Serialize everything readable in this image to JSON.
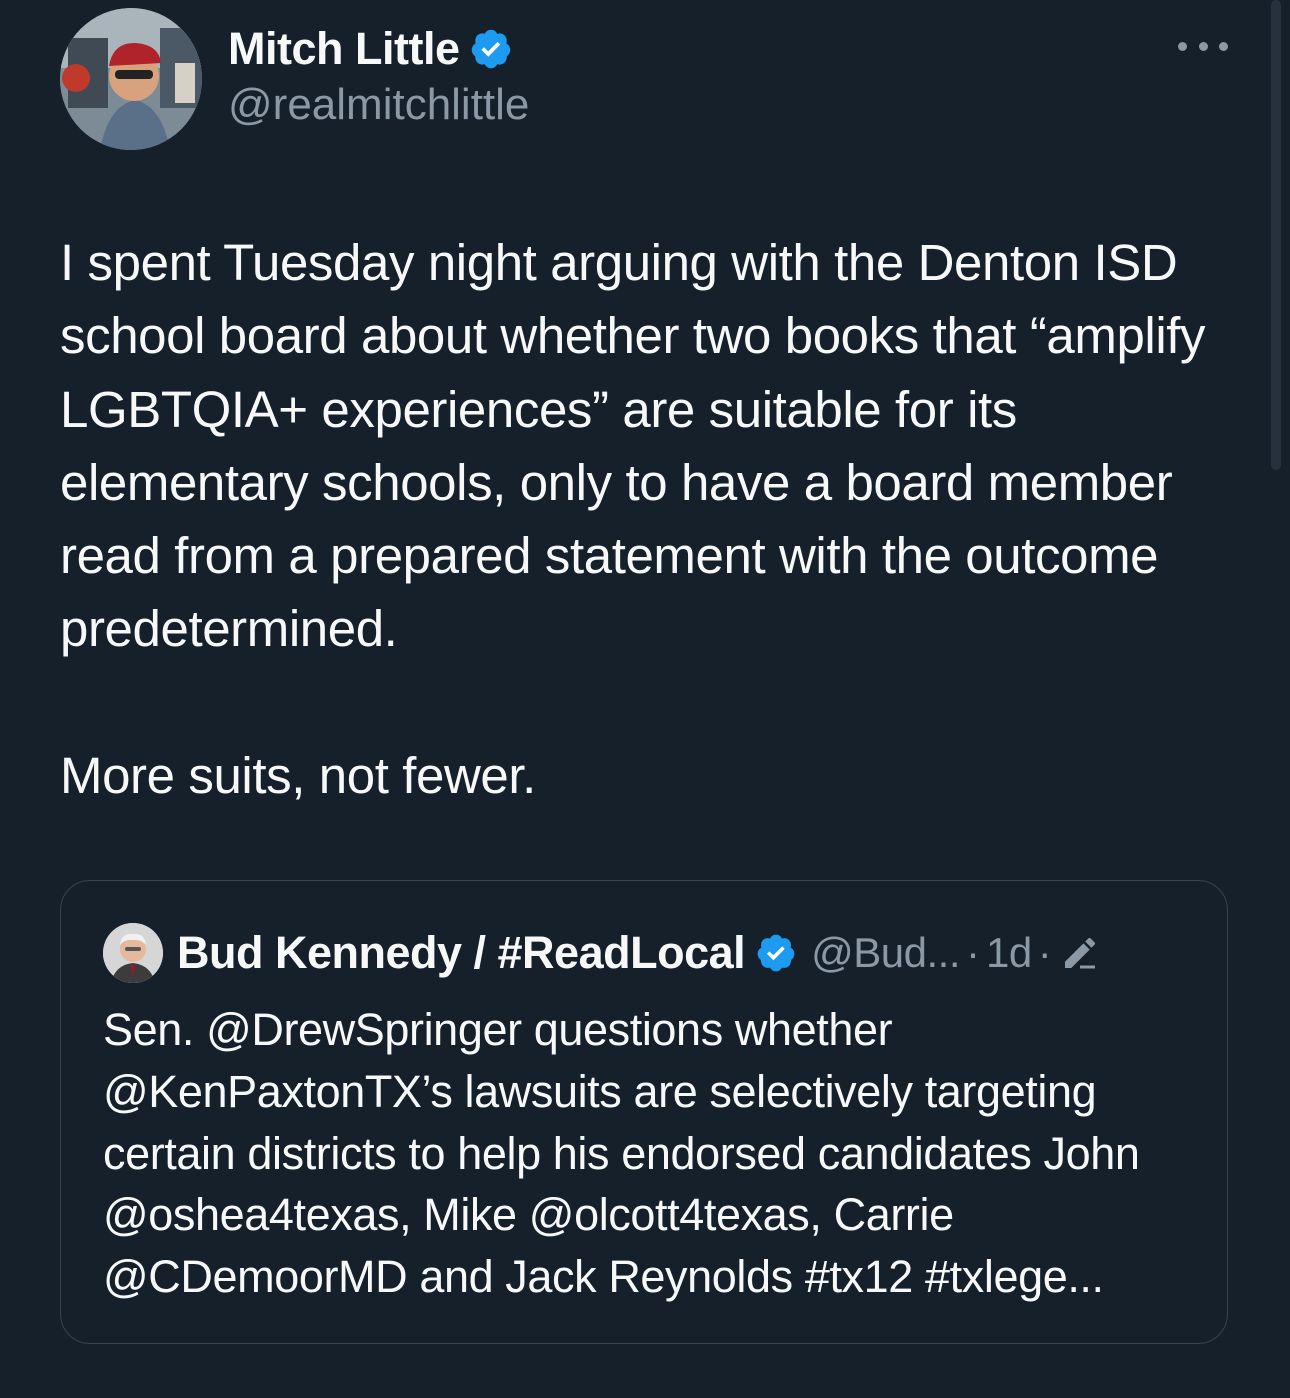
{
  "tweet": {
    "author": {
      "display_name": "Mitch Little",
      "handle": "@realmitchlittle",
      "verified": true
    },
    "more_icon": "more-horizontal-icon",
    "text": "I spent Tuesday night arguing with the Denton ISD school board about whether two books that “amplify LGBTQIA+ experiences” are suitable for its elementary schools, only to have a board member read from a prepared statement with the outcome predetermined.\n\nMore suits, not fewer.",
    "quoted_tweet": {
      "display_name": "Bud Kennedy / #ReadLocal",
      "handle": "@Bud...",
      "separator": "·",
      "time": "1d",
      "verified": true,
      "edited_icon": "edit-pencil-icon",
      "text": "Sen. @DrewSpringer questions whether @KenPaxtonTX’s lawsuits are selectively targeting certain districts to help his endorsed candidates John @oshea4texas, Mike @olcott4texas, Carrie @CDemoorMD and Jack Reynolds #tx12 #txlege..."
    }
  },
  "colors": {
    "background": "#15202b",
    "text_primary": "#f7f9f9",
    "text_secondary": "#8b98a5",
    "verified_blue": "#1d9bf0",
    "border": "#38444d"
  }
}
